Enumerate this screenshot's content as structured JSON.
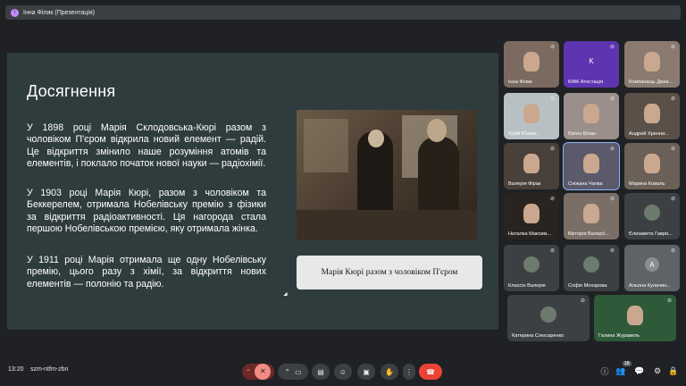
{
  "presenter": {
    "label": "Інна Філик (Презентація)",
    "avatar_letter": "І"
  },
  "slide": {
    "title": "Досягнення",
    "paragraphs": [
      "У 1898 році Марія Склодовська-Кюрі разом з чоловіком П'єром відкрила новий елемент — радій. Це відкриття змінило наше розуміння атомів та елементів, і поклало початок нової науки — радіохімії.",
      "У 1903 році Марія Кюрі, разом з чоловіком та Беккерелем, отримала Нобелівську премію з фізики за відкриття радіоактивності. Ця нагорода стала першою Нобелівською премією, яку отримала жінка.",
      "У 1911 році Марія отримала ще одну Нобелівську премію, цього разу з хімії, за відкриття нових елементів — полонію та радію."
    ],
    "caption": "Марія Кюрі разом з чоловіком П'єром"
  },
  "participants": [
    {
      "name": "Інна Філик",
      "letter": "",
      "color": "#7a6a60"
    },
    {
      "name": "КІФК Атестація",
      "letter": "K",
      "color": "#5e35b1"
    },
    {
      "name": "Компанієць Джек...",
      "letter": "",
      "color": "#8a7a70"
    },
    {
      "name": "Юрій Юшин...",
      "letter": "",
      "color": "#b8c0c4"
    },
    {
      "name": "Євген Білан",
      "letter": "",
      "color": "#9a8f8a"
    },
    {
      "name": "Андрей Хренни...",
      "letter": "",
      "color": "#5a5048"
    },
    {
      "name": "Валерія Фірак",
      "letter": "",
      "color": "#4a403a"
    },
    {
      "name": "Сніжана Чапка",
      "letter": "",
      "color": "#5a5a6a"
    },
    {
      "name": "Марина Коваль",
      "letter": "",
      "color": "#6a6058"
    },
    {
      "name": "Наталка Максим...",
      "letter": "",
      "color": "#2a2420"
    },
    {
      "name": "Вікторія Валерії...",
      "letter": "",
      "color": "#7a6e66"
    },
    {
      "name": "Єлизавета Гаври...",
      "letter": "",
      "color": "#3c4043"
    },
    {
      "name": "Классін Валерія",
      "letter": "",
      "color": "#3c4043"
    },
    {
      "name": "Софія Мохарова",
      "letter": "",
      "color": "#3c4043"
    },
    {
      "name": "Альона Кулачин...",
      "letter": "A",
      "color": "#5f6368"
    },
    {
      "name": "Катерина Слюсаренко",
      "letter": "",
      "color": "#3c4043"
    },
    {
      "name": "Галина Журавель",
      "letter": "",
      "color": "#2e5a3a"
    }
  ],
  "bottom": {
    "time": "13:20",
    "meeting_code": "szm-ntfm-zbn",
    "participant_count": "18"
  },
  "icons": {
    "mic_off": "mic-off-icon",
    "camera": "camera-icon",
    "captions": "captions-icon",
    "emoji": "emoji-icon",
    "present": "present-icon",
    "hand": "raise-hand-icon",
    "more": "more-icon",
    "end_call": "end-call-icon",
    "info": "info-icon",
    "people": "people-icon",
    "chat": "chat-icon",
    "activities": "activities-icon"
  },
  "colors": {
    "end_call": "#ea4335",
    "slide_bg": "#2f3c3e",
    "active_speaker": "#8ab4f8"
  }
}
